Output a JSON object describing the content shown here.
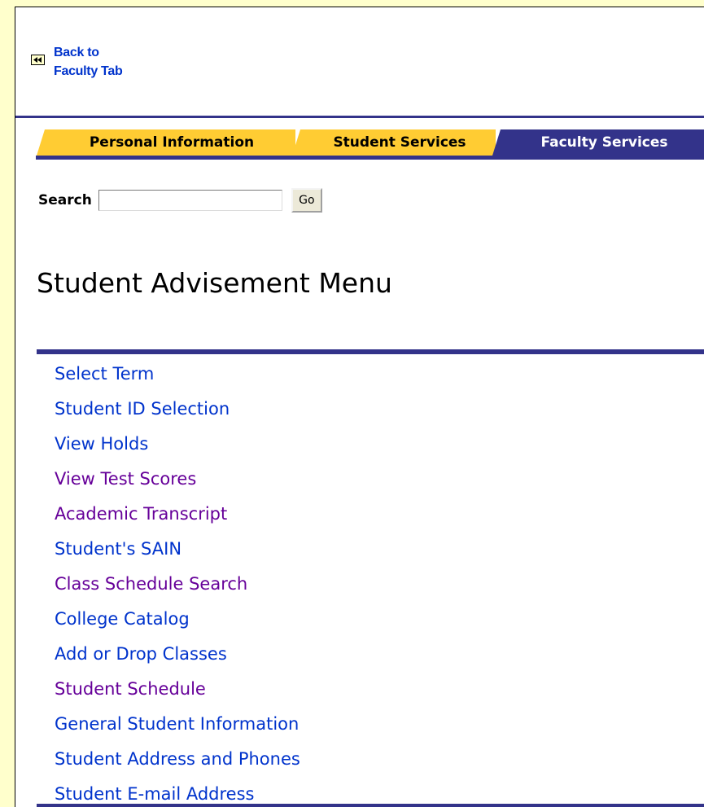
{
  "back_link": {
    "line1": "Back to",
    "line2": "Faculty Tab",
    "icon": "rewind-icon"
  },
  "tabs": [
    {
      "label": "Personal Information",
      "active": false,
      "color": "#ffcc33"
    },
    {
      "label": "Student Services",
      "active": false,
      "color": "#ffcc33"
    },
    {
      "label": "Faculty Services",
      "active": true,
      "color": "#33338a"
    }
  ],
  "search": {
    "label": "Search",
    "value": "",
    "button_label": "Go"
  },
  "page_title": "Student Advisement Menu",
  "menu_items": [
    {
      "label": "Select Term",
      "color": "#0033cc"
    },
    {
      "label": "Student ID Selection",
      "color": "#0033cc"
    },
    {
      "label": "View Holds",
      "color": "#0033cc"
    },
    {
      "label": "View Test Scores",
      "color": "#660099"
    },
    {
      "label": "Academic Transcript",
      "color": "#660099"
    },
    {
      "label": "Student's SAIN",
      "color": "#0033cc"
    },
    {
      "label": "Class Schedule Search",
      "color": "#660099"
    },
    {
      "label": "College Catalog",
      "color": "#0033cc"
    },
    {
      "label": "Add or Drop Classes",
      "color": "#0033cc"
    },
    {
      "label": "Student Schedule",
      "color": "#660099"
    },
    {
      "label": "General Student Information",
      "color": "#0033cc"
    },
    {
      "label": "Student Address and Phones",
      "color": "#0033cc"
    },
    {
      "label": "Student E-mail Address",
      "color": "#0033cc"
    }
  ],
  "colors": {
    "background": "#ffffcc",
    "accent": "#33338a",
    "tab_inactive": "#ffcc33",
    "link": "#0033cc",
    "visited_link": "#660099"
  }
}
